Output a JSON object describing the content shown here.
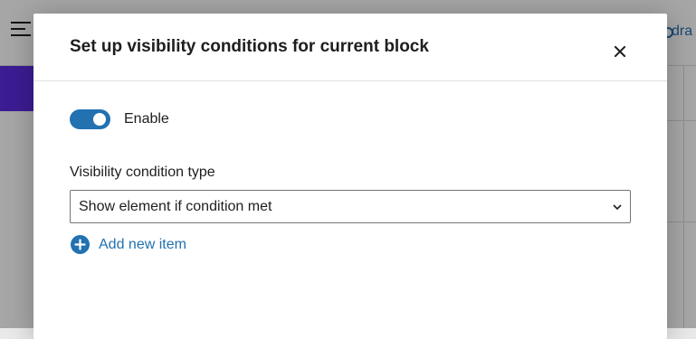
{
  "background": {
    "top_link_text": "dra",
    "accent_color": "#5b2ce0"
  },
  "modal": {
    "title": "Set up visibility conditions for current block",
    "close_icon": "close-icon",
    "enable_toggle": {
      "label": "Enable",
      "checked": true,
      "color": "#2271b1"
    },
    "condition_type": {
      "label": "Visibility condition type",
      "selected": "Show element if condition met",
      "icon": "chevron-down-icon"
    },
    "add_item": {
      "label": "Add new item",
      "icon": "plus-circle-icon",
      "color": "#2271b1"
    }
  }
}
